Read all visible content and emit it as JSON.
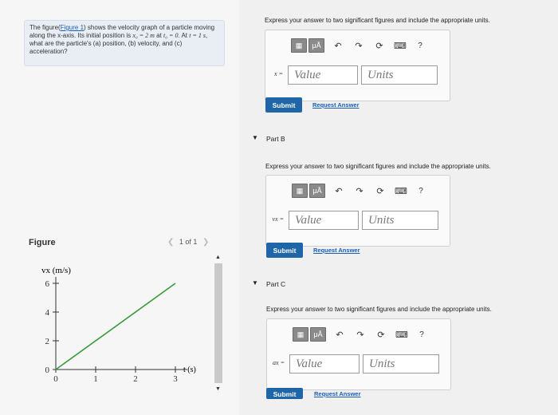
{
  "problem": {
    "text_pre": "The figure(",
    "figure_link": "Figure 1",
    "text_1": ") shows the velocity graph of a particle moving along the x-axis. Its initial position is ",
    "x0_expr": "x₀ = 2 m",
    "text_2": " at ",
    "t0_expr": "t₀ = 0",
    "text_3": ". At ",
    "t_expr": "t = 1 s",
    "text_4": ", what are the particle's (a) position, (b) velocity, and (c) acceleration?"
  },
  "figure": {
    "label": "Figure",
    "pager": "1 of 1",
    "prev_icon": "chevron-left",
    "next_icon": "chevron-right"
  },
  "chart_data": {
    "type": "line",
    "ylabel": "vx (m/s)",
    "xlabel": "t (s)",
    "xlim": [
      0,
      3
    ],
    "ylim": [
      0,
      6
    ],
    "x_ticks": [
      "0",
      "1",
      "2",
      "3"
    ],
    "y_ticks": [
      "0",
      "2",
      "4",
      "6"
    ],
    "series": [
      {
        "x": [
          0,
          3
        ],
        "y": [
          0,
          6
        ],
        "color": "#3a9a3a"
      }
    ],
    "grid": false
  },
  "parts": [
    {
      "title": "",
      "instruction": "Express your answer to two significant figures and include the appropriate units.",
      "variable": "x =",
      "value_placeholder": "Value",
      "units_placeholder": "Units",
      "submit": "Submit",
      "request": "Request Answer"
    },
    {
      "title": "Part B",
      "instruction": "Express your answer to two significant figures and include the appropriate units.",
      "variable": "vx =",
      "value_placeholder": "Value",
      "units_placeholder": "Units",
      "submit": "Submit",
      "request": "Request Answer"
    },
    {
      "title": "Part C",
      "instruction": "Express your answer to two significant figures and include the appropriate units.",
      "variable": "ax =",
      "value_placeholder": "Value",
      "units_placeholder": "Units",
      "submit": "Submit",
      "request": "Request Answer"
    }
  ],
  "toolbar": {
    "templates_icon": "template-icon",
    "mu_label": "μÅ",
    "undo": "↶",
    "redo": "↷",
    "reset": "⟳",
    "keyboard": "⌨",
    "help": "?"
  }
}
